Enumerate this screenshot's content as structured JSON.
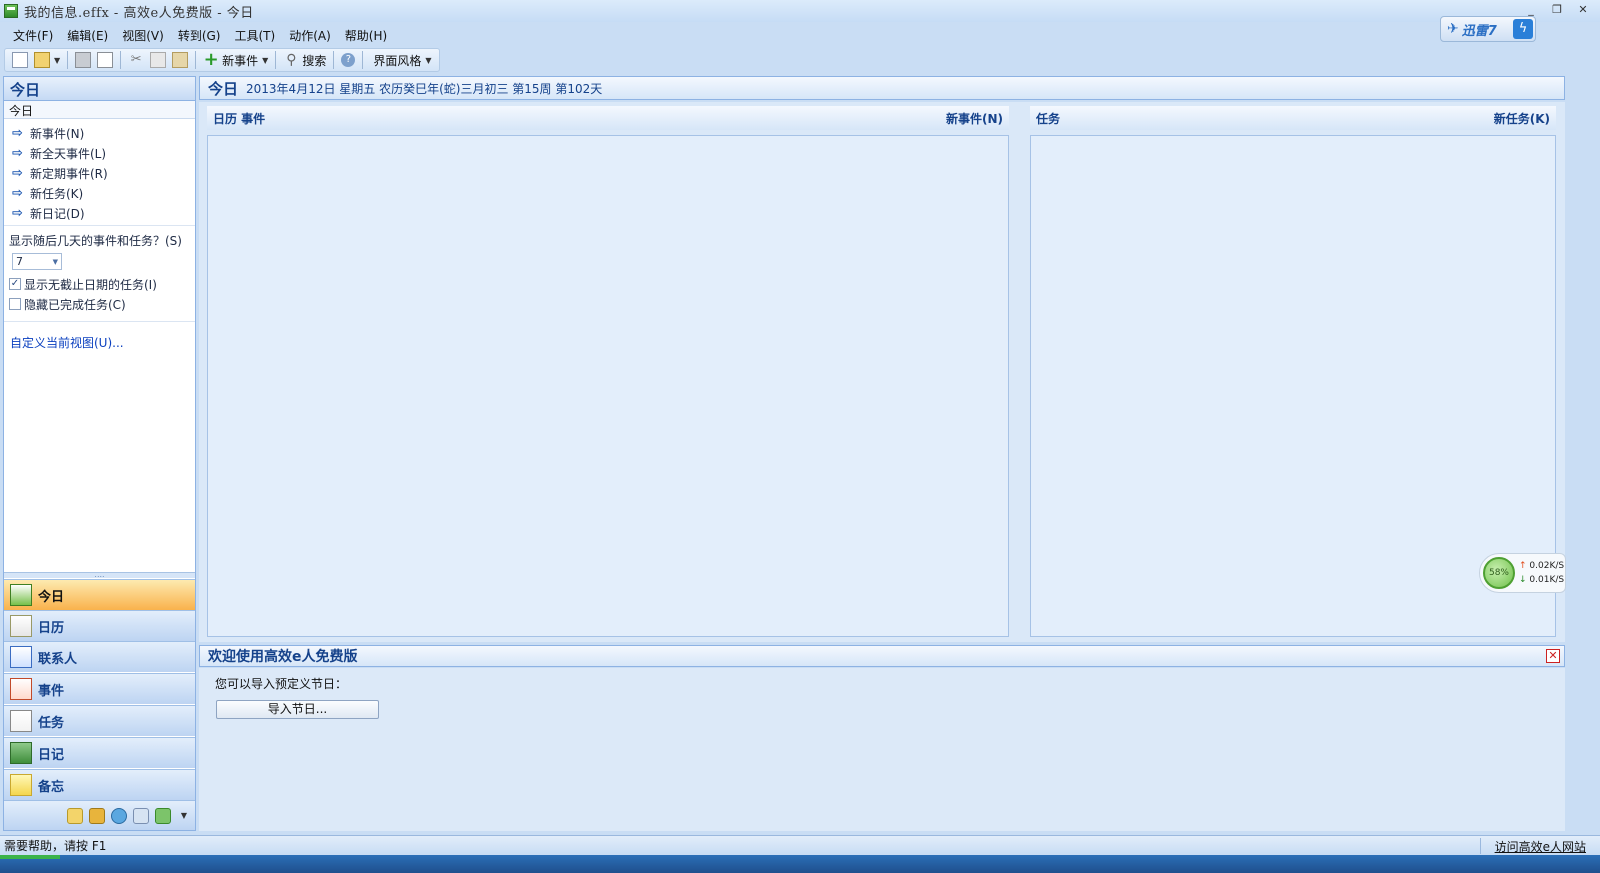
{
  "window": {
    "title": "我的信息.effx - 高效e人免费版 - 今日",
    "controls": [
      "_",
      "❐",
      "✕"
    ]
  },
  "xunlei": {
    "label": "迅雷7"
  },
  "menu": [
    {
      "label": "文件(F)"
    },
    {
      "label": "编辑(E)"
    },
    {
      "label": "视图(V)"
    },
    {
      "label": "转到(G)"
    },
    {
      "label": "工具(T)"
    },
    {
      "label": "动作(A)"
    },
    {
      "label": "帮助(H)"
    }
  ],
  "toolbar": {
    "new_event": "新事件",
    "search": "搜索",
    "theme": "界面风格"
  },
  "left": {
    "header": "今日",
    "subheader": "今日",
    "actions": [
      {
        "label": "新事件(N)"
      },
      {
        "label": "新全天事件(L)"
      },
      {
        "label": "新定期事件(R)"
      },
      {
        "label": "新任务(K)"
      },
      {
        "label": "新日记(D)"
      }
    ],
    "days_question": "显示随后几天的事件和任务？(S)",
    "days_value": "7",
    "show_no_deadline": "显示无截止日期的任务(I)",
    "show_no_deadline_checked": true,
    "hide_completed": "隐藏已完成任务(C)",
    "hide_completed_checked": false,
    "customize": "自定义当前视图(U)..."
  },
  "nav": {
    "active": "今日",
    "items": [
      {
        "label": "今日",
        "icon": "home-icon"
      },
      {
        "label": "日历",
        "icon": "calendar-icon"
      },
      {
        "label": "联系人",
        "icon": "contacts-icon"
      },
      {
        "label": "事件",
        "icon": "events-icon"
      },
      {
        "label": "任务",
        "icon": "tasks-icon"
      },
      {
        "label": "日记",
        "icon": "diary-icon"
      },
      {
        "label": "备忘",
        "icon": "memo-icon"
      }
    ]
  },
  "main": {
    "title": "今日",
    "info": "2013年4月12日  星期五  农历癸巳年(蛇)三月初三  第15周  第102天",
    "calendar_header": "日历 事件",
    "new_event_link": "新事件(N)",
    "tasks_header": "任务",
    "new_task_link": "新任务(K)"
  },
  "welcome": {
    "title": "欢迎使用高效e人免费版",
    "text": "您可以导入预定义节日：",
    "import_button": "导入节日..."
  },
  "network": {
    "percent": "58%",
    "up": "0.02K/S",
    "down": "0.01K/S"
  },
  "status": {
    "help": "需要帮助，请按 F1",
    "visit_link": "访问高效e人网站"
  }
}
